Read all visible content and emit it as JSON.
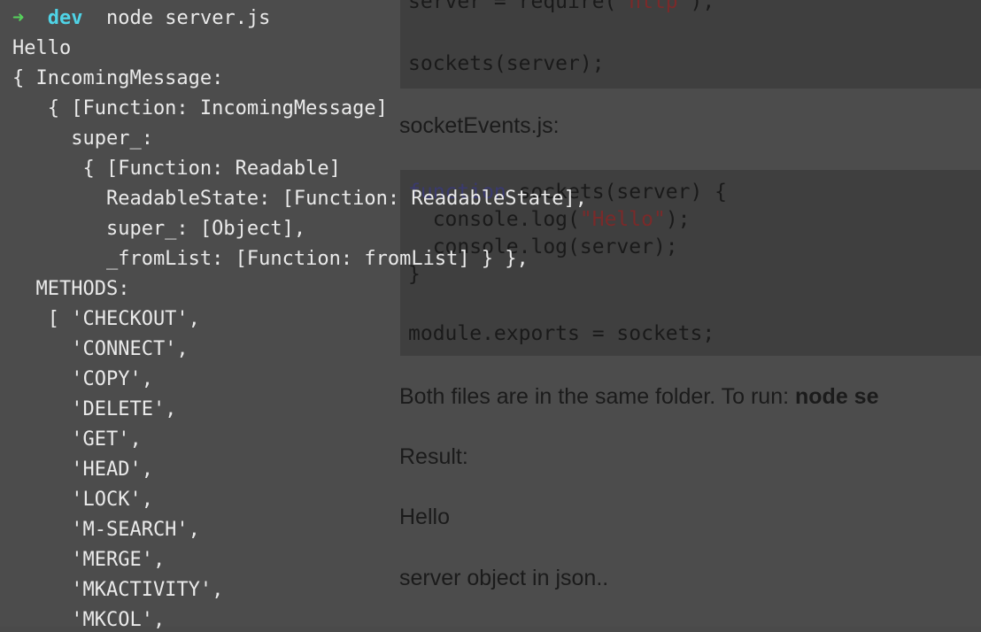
{
  "background_page": {
    "code_top_lines": [
      {
        "text": "server = require('http');",
        "kind": "mixed"
      },
      {
        "text": "sockets(server);",
        "kind": "plain"
      }
    ],
    "heading_socket_events": "socketEvents.js:",
    "code_mid_lines": [
      "function sockets(server) {",
      "  console.log(\"Hello\");",
      "  console.log(server);",
      "}",
      "module.exports = sockets;"
    ],
    "run_text_prefix": "Both files are in the same folder. To run: ",
    "run_text_cmd": "node se",
    "result_label": "Result:",
    "result_hello": "Hello",
    "result_desc": "server object in json.."
  },
  "terminal": {
    "prompt_arrow": "➜",
    "prompt_dir": "dev",
    "prompt_cmd": "node server.js",
    "output_lines": [
      "Hello",
      "{ IncomingMessage:",
      "   { [Function: IncomingMessage]",
      "     super_:",
      "      { [Function: Readable]",
      "        ReadableState: [Function: ReadableState],",
      "        super_: [Object],",
      "        _fromList: [Function: fromList] } },",
      "  METHODS:",
      "   [ 'CHECKOUT',",
      "     'CONNECT',",
      "     'COPY',",
      "     'DELETE',",
      "     'GET',",
      "     'HEAD',",
      "     'LOCK',",
      "     'M-SEARCH',",
      "     'MERGE',",
      "     'MKACTIVITY',",
      "     'MKCOL',"
    ]
  }
}
